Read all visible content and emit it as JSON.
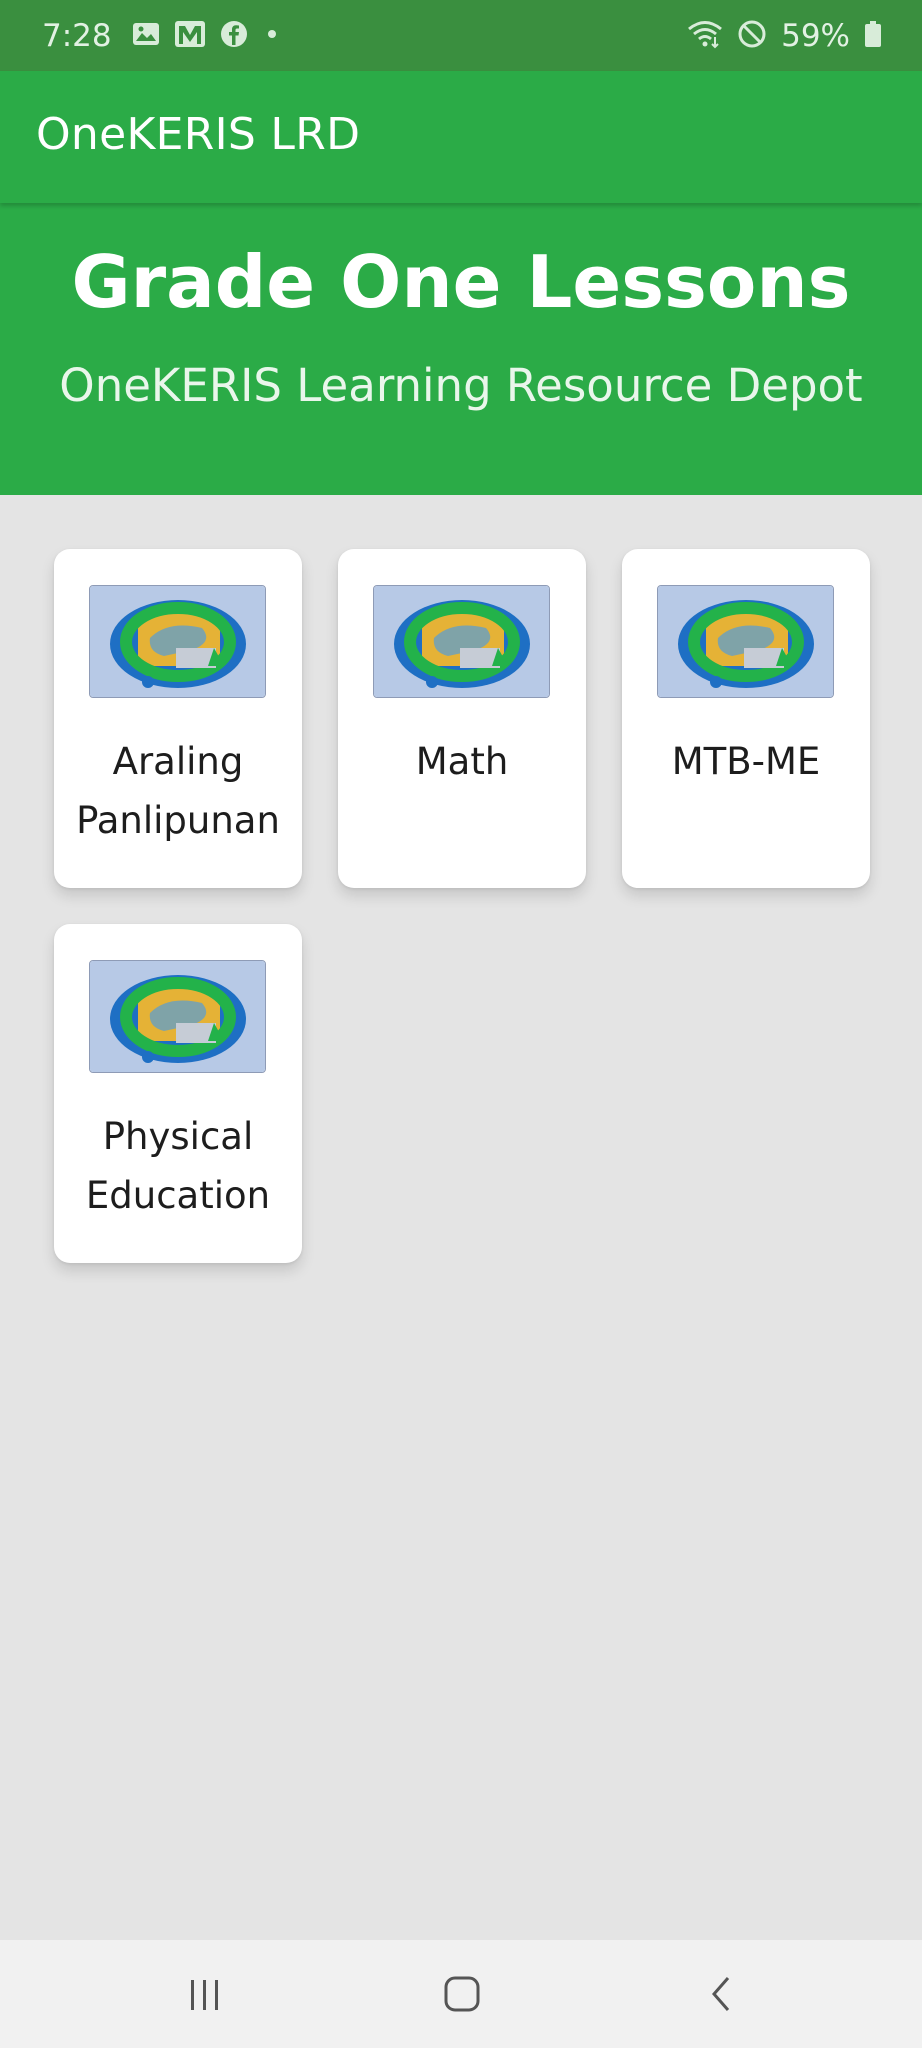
{
  "status_bar": {
    "time": "7:28",
    "battery": "59%",
    "left_icons": [
      "gallery-icon",
      "gmail-icon",
      "facebook-icon",
      "notification-dot-icon"
    ],
    "right_icons": [
      "wifi-icon",
      "do-not-disturb-icon",
      "battery-icon"
    ]
  },
  "app_bar": {
    "title": "OneKERIS LRD"
  },
  "header": {
    "title": "Grade One Lessons",
    "subtitle": "OneKERIS Learning Resource Depot"
  },
  "subjects": [
    {
      "label": "Araling Panlipunan",
      "icon": "onekeris-logo-thumbnail"
    },
    {
      "label": "Math",
      "icon": "onekeris-logo-thumbnail"
    },
    {
      "label": "MTB-ME",
      "icon": "onekeris-logo-thumbnail"
    },
    {
      "label": "Physical Education",
      "icon": "onekeris-logo-thumbnail"
    }
  ],
  "nav_bar": {
    "buttons": [
      "recent-apps-icon",
      "home-icon",
      "back-icon"
    ]
  },
  "colors": {
    "status_bar": "#3a8f3f",
    "primary": "#2bab47",
    "background": "#e4e4e4",
    "card": "#ffffff",
    "nav_bar": "#f1f1f1"
  }
}
